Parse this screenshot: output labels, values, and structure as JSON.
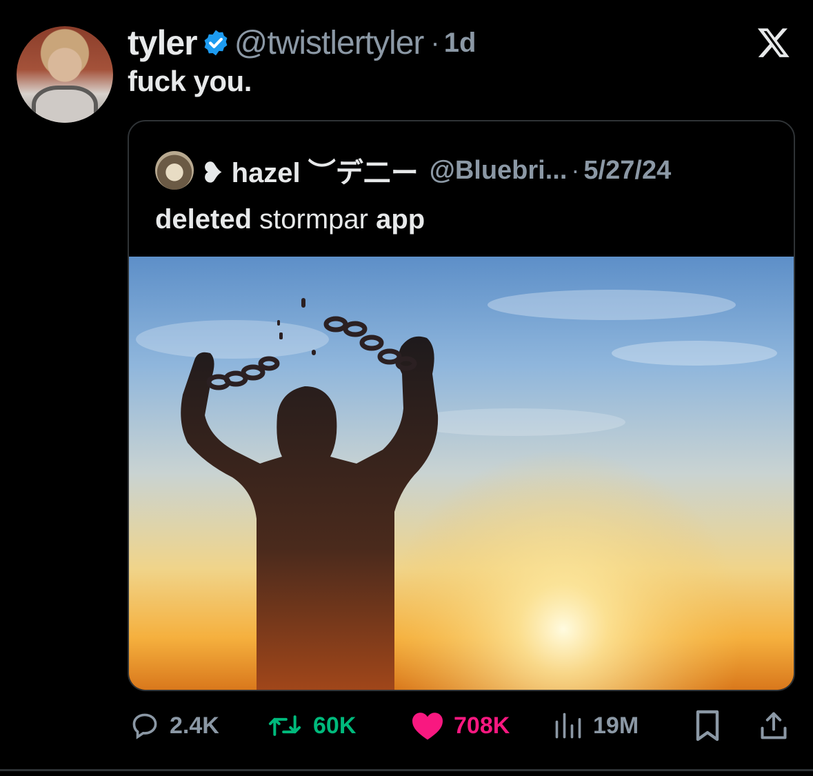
{
  "tweet": {
    "author_name": "tyler",
    "author_handle": "@twistlertyler",
    "separator": "·",
    "time": "1d",
    "text": "fuck you."
  },
  "quoted_tweet": {
    "author_name": "❥ hazel ︶デ二ー",
    "author_handle": "@Bluebri...",
    "separator": "·",
    "date": "5/27/24",
    "text_bold_1": "deleted",
    "text_regular": " stormpar ",
    "text_bold_2": "app"
  },
  "actions": {
    "replies": "2.4K",
    "reposts": "60K",
    "likes": "708K",
    "views": "19M"
  },
  "colors": {
    "background": "#000000",
    "text": "#e7e9ea",
    "muted": "#8b98a5",
    "verified": "#1d9bf0",
    "repost": "#00ba7c",
    "like": "#f91880"
  },
  "icons": [
    "verified-badge-icon",
    "x-logo-icon",
    "reply-icon",
    "repost-icon",
    "like-icon",
    "views-icon",
    "bookmark-icon",
    "share-icon"
  ]
}
